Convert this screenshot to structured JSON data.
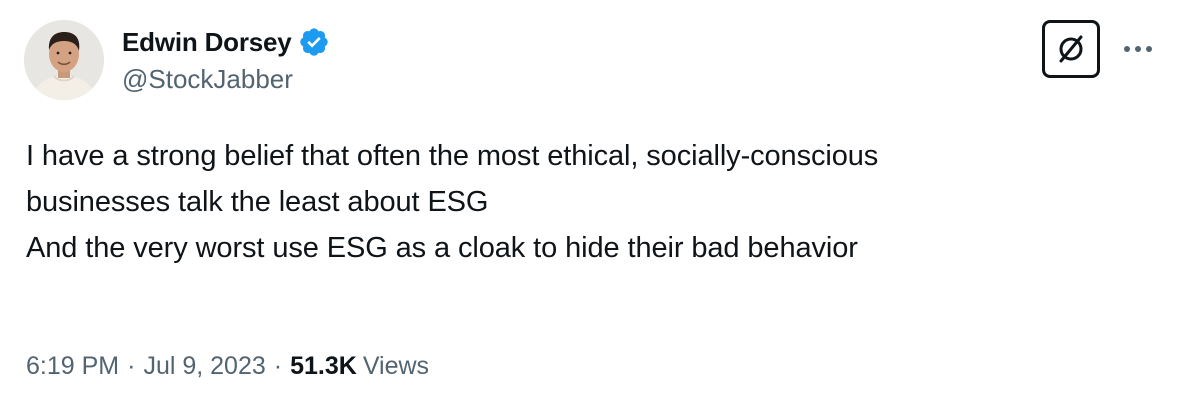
{
  "author": {
    "display_name": "Edwin Dorsey",
    "handle": "@StockJabber",
    "verified": true,
    "verified_color": "#1d9bf0"
  },
  "tweet": {
    "lines": [
      "I have a strong belief that often the most ethical, socially-conscious",
      "businesses talk the least about ESG",
      "",
      "And the very worst use ESG as a cloak to hide their bad behavior"
    ]
  },
  "meta": {
    "time": "6:19 PM",
    "separator": "·",
    "date": "Jul 9, 2023",
    "views_count": "51.3K",
    "views_label": "Views"
  },
  "icons": {
    "grok": "grok-icon",
    "more": "more-icon",
    "verified": "verified-badge-icon"
  },
  "colors": {
    "text_primary": "#0f1419",
    "text_secondary": "#536471",
    "verified_blue": "#1d9bf0"
  }
}
